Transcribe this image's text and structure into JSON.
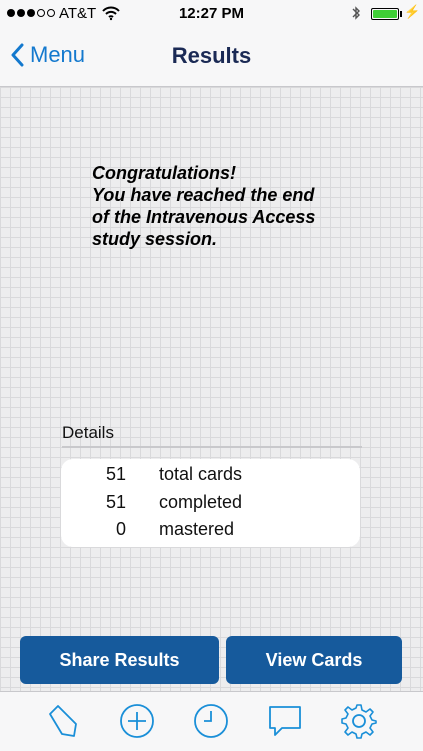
{
  "status_bar": {
    "carrier": "AT&T",
    "time": "12:27 PM",
    "signal_bars_filled": 3,
    "signal_bars_total": 5,
    "battery_level": 1.0,
    "battery_color": "#3ecf36"
  },
  "nav": {
    "back_label": "Menu",
    "title": "Results"
  },
  "message": {
    "lines": [
      "Congratulations!",
      "You have reached the end",
      "of the Intravenous Access",
      "study session."
    ]
  },
  "details": {
    "heading": "Details",
    "stats": [
      {
        "value": "51",
        "label": "total cards"
      },
      {
        "value": "51",
        "label": "completed"
      },
      {
        "value": "0",
        "label": "mastered"
      }
    ]
  },
  "buttons": {
    "share_label": "Share Results",
    "view_label": "View Cards"
  },
  "tabs": [
    {
      "icon": "bookmark-icon"
    },
    {
      "icon": "plus-circle-icon"
    },
    {
      "icon": "clock-icon"
    },
    {
      "icon": "speech-bubble-icon"
    },
    {
      "icon": "gear-icon"
    }
  ],
  "colors": {
    "accent": "#1479ce",
    "button": "#165a9c",
    "title": "#1b2a55",
    "tab_icon": "#1a8fd8"
  }
}
